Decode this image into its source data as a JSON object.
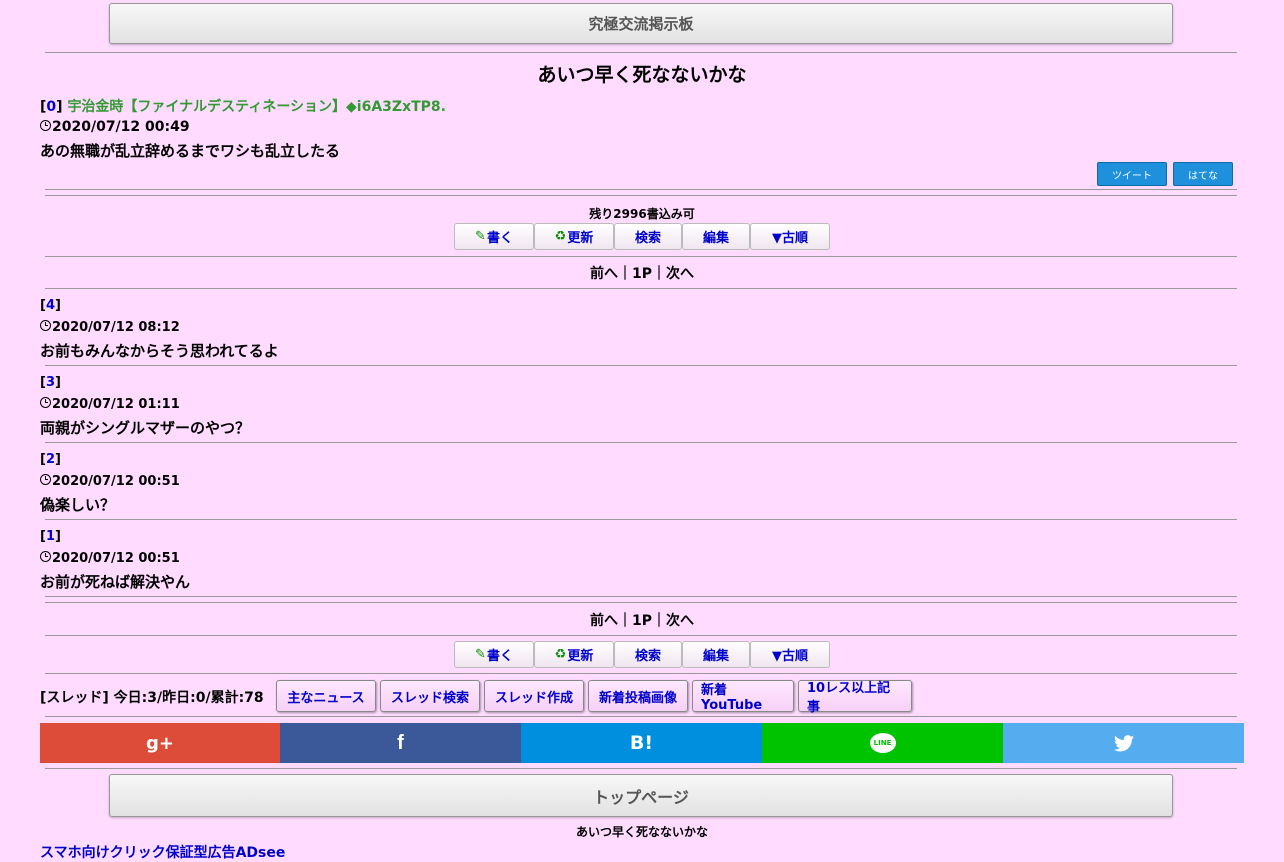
{
  "board": {
    "title": "究極交流掲示板"
  },
  "thread": {
    "title": "あいつ早く死なないかな",
    "op": {
      "number": "0",
      "author": "宇治金時【ファイナルデスティネーション】◆i6A3ZxTP8.",
      "date": "2020/07/12 00:49",
      "message": "あの無職が乱立辞めるまでワシも乱立したる"
    }
  },
  "share": {
    "tweet": "ツイート",
    "hatena": "はてな"
  },
  "remaining": "残り2996書込み可",
  "nav": {
    "write": "書く",
    "refresh": "更新",
    "search": "検索",
    "edit": "編集",
    "order": "▼古順"
  },
  "pager": {
    "text": "前へ｜1P｜次へ"
  },
  "posts": [
    {
      "number": "4",
      "date": "2020/07/12 08:12",
      "message": "お前もみんなからそう思われてるよ"
    },
    {
      "number": "3",
      "date": "2020/07/12 01:11",
      "message": "両親がシングルマザーのやつ？"
    },
    {
      "number": "2",
      "date": "2020/07/12 00:51",
      "message": "偽楽しい？"
    },
    {
      "number": "1",
      "date": "2020/07/12 00:51",
      "message": "お前が死ねば解決やん"
    }
  ],
  "stats": "[スレッド] 今日:3/昨日:0/累計:78",
  "links": {
    "news": "主なニュース",
    "thread_search": "スレッド検索",
    "thread_create": "スレッド作成",
    "new_images": "新着投稿画像",
    "new_youtube": "新着YouTube",
    "ten_res": "10レス以上記事"
  },
  "social": {
    "gplus": "g+",
    "facebook": "f",
    "hatena": "B!",
    "line": "LINE",
    "twitter": "twitter"
  },
  "footer": {
    "top_page": "トップページ",
    "thread_title": "あいつ早く死なないかな",
    "ad_link": "スマホ向けクリック保証型広告ADsee"
  },
  "colors": {
    "background": "#ffdcff",
    "author_green": "#339933",
    "link_blue": "#0000cc",
    "gplus": "#dd4b39",
    "facebook": "#3b5998",
    "hatena": "#008fde",
    "line": "#00c300",
    "twitter": "#55acee"
  }
}
